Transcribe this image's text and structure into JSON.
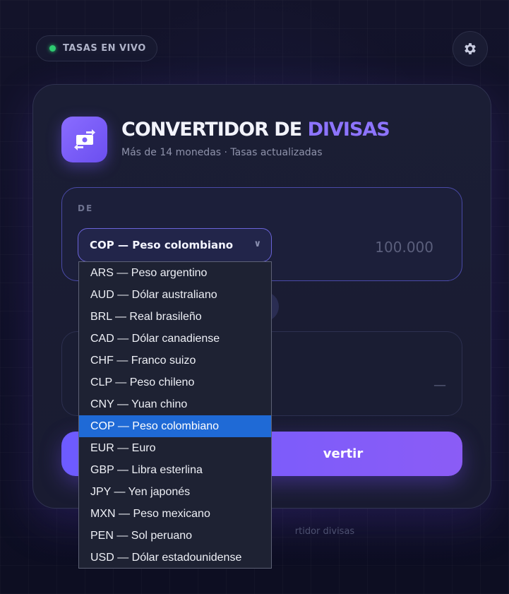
{
  "header": {
    "live_label": "TASAS EN VIVO",
    "settings_icon": "gear-icon"
  },
  "app": {
    "icon": "money-exchange-icon",
    "title_main": "CONVERTIDOR DE ",
    "title_accent": "DIVISAS",
    "subtitle": "Más de 14 monedas · Tasas actualizadas"
  },
  "from": {
    "label": "DE",
    "selected": "COP — Peso colombiano",
    "amount_placeholder": "100.000"
  },
  "to": {
    "amount": "—"
  },
  "convert_button": "vertir",
  "footer": "rtidor divisas",
  "dropdown": {
    "options": [
      "ARS — Peso argentino",
      "AUD — Dólar australiano",
      "BRL — Real brasileño",
      "CAD — Dólar canadiense",
      "CHF — Franco suizo",
      "CLP — Peso chileno",
      "CNY — Yuan chino",
      "COP — Peso colombiano",
      "EUR — Euro",
      "GBP — Libra esterlina",
      "JPY — Yen japonés",
      "MXN — Peso mexicano",
      "PEN — Sol peruano",
      "USD — Dólar estadounidense"
    ],
    "selected_index": 7
  },
  "colors": {
    "accent": "#8d74ff",
    "live_dot": "#2ecc71",
    "selected_option": "#1f6ad6"
  }
}
